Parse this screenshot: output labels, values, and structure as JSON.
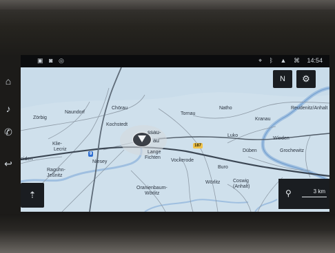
{
  "status_bar": {
    "left_icons": [
      "sim-icon",
      "phone-icon",
      "connect-icon"
    ],
    "right_icons": [
      "location-icon",
      "bluetooth-icon",
      "signal-icon",
      "network-icon"
    ],
    "time": "14:54"
  },
  "map": {
    "compass_label": "N",
    "scale_value": "3 km",
    "route_badges": {
      "b187": "187",
      "a9": "9"
    },
    "places": {
      "zorbig": "Zörbig",
      "naundorf": "Naundorf",
      "chorau": "Chörau",
      "kochstedt": "Kochstedt",
      "dessau": "ssau-",
      "rosslau": "au",
      "tornau": "Tornau",
      "natho": "Natho",
      "kranau": "Kranau",
      "reudnitz": "Reudenitz/Anhalt",
      "klieken": "Klie-",
      "lenzig": "Lecriz",
      "luko": "Luko",
      "wiesen": "Wieden",
      "kleinlange": "Lange",
      "fichten": "Fichten",
      "vockerode": "Vockerode",
      "duben": "Düben",
      "grochewitz": "Grochewitz",
      "niesey": "Niesey",
      "raguhn": "Raguhn-",
      "jessnitz": "Jeßnitz",
      "oranienbaum": "Oranienbaum-",
      "woerlitz2": "Wörlitz",
      "woerlitz": "Wörlitz",
      "coswig": "Coswig",
      "anhalt": "(Anhalt)",
      "buro": "Buro",
      "heiden": "eiden"
    }
  }
}
